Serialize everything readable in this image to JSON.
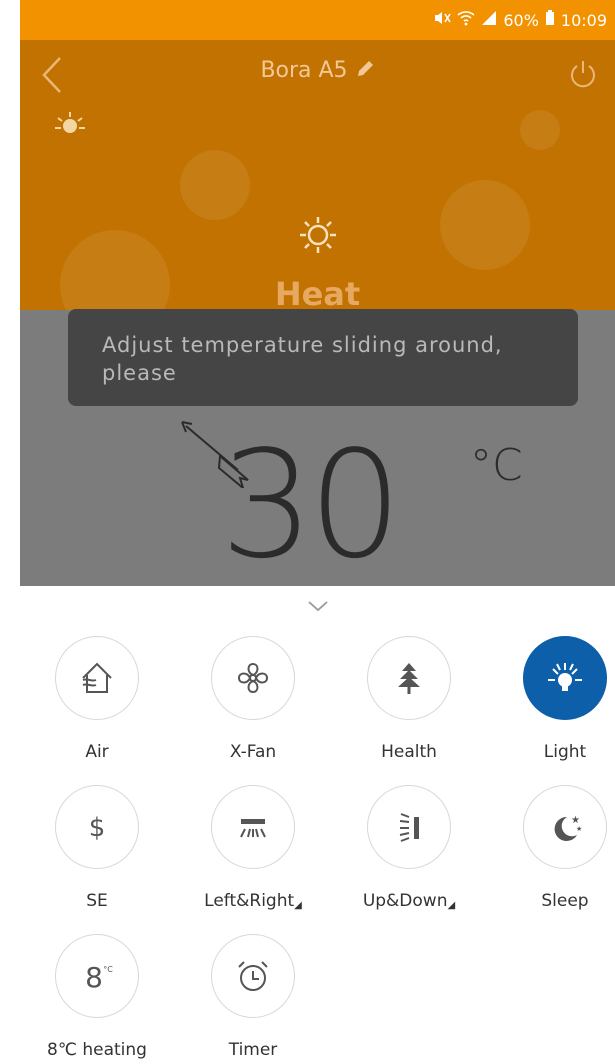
{
  "status_bar": {
    "battery": "60%",
    "time": "10:09",
    "icons": [
      "mute-icon",
      "wifi-icon",
      "signal-icon",
      "battery-icon"
    ]
  },
  "header": {
    "title": "Bora A5",
    "back_icon": "back-chevron-icon",
    "edit_icon": "pencil-icon",
    "power_icon": "power-icon"
  },
  "mode": {
    "label": "Heat",
    "icon": "sun-icon"
  },
  "toast": {
    "message": "Adjust temperature sliding around, please"
  },
  "temperature": {
    "value": "30",
    "unit": "°C"
  },
  "controls": [
    {
      "label": "Air",
      "icon": "air-house-icon",
      "active": false
    },
    {
      "label": "X-Fan",
      "icon": "fan-icon",
      "active": false
    },
    {
      "label": "Health",
      "icon": "tree-icon",
      "active": false
    },
    {
      "label": "Light",
      "icon": "light-bulb-icon",
      "active": true
    },
    {
      "label": "SE",
      "icon": "dollar-icon",
      "active": false
    },
    {
      "label": "Left&Right",
      "icon": "swing-horizontal-icon",
      "active": false,
      "dropdown": true
    },
    {
      "label": "Up&Down",
      "icon": "swing-vertical-icon",
      "active": false,
      "dropdown": true
    },
    {
      "label": "Sleep",
      "icon": "moon-stars-icon",
      "active": false
    },
    {
      "label": "8℃ heating",
      "icon": "eight-degree-icon",
      "active": false
    },
    {
      "label": "Timer",
      "icon": "alarm-clock-icon",
      "active": false
    }
  ],
  "colors": {
    "status_bar": "#f39200",
    "header_bg": "#c27200",
    "active_button": "#0c5fa8"
  }
}
